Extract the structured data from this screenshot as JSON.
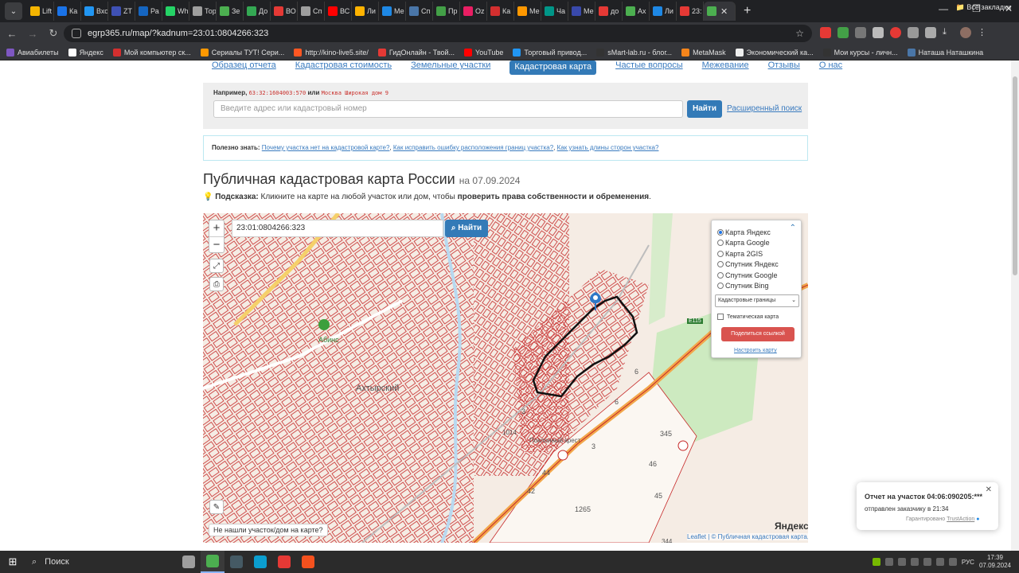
{
  "browser": {
    "tabs": [
      {
        "label": "Lift",
        "color": "#f4b400"
      },
      {
        "label": "Ка",
        "color": "#1a73e8"
      },
      {
        "label": "Вхо",
        "color": "#2196f3"
      },
      {
        "label": "ZT",
        "color": "#3f51b5"
      },
      {
        "label": "Ра",
        "color": "#1565c0"
      },
      {
        "label": "Wh",
        "color": "#25d366"
      },
      {
        "label": "Тор",
        "color": "#9e9e9e"
      },
      {
        "label": "Зе",
        "color": "#4caf50"
      },
      {
        "label": "До",
        "color": "#34a853"
      },
      {
        "label": "ВО",
        "color": "#e53935"
      },
      {
        "label": "Сп",
        "color": "#9e9e9e"
      },
      {
        "label": "ВС",
        "color": "#ff0000"
      },
      {
        "label": "Ли",
        "color": "#ffb300"
      },
      {
        "label": "Ме",
        "color": "#1e88e5"
      },
      {
        "label": "Сп",
        "color": "#4a76a8"
      },
      {
        "label": "Пр",
        "color": "#43a047"
      },
      {
        "label": "Oz",
        "color": "#e91e63"
      },
      {
        "label": "Ка",
        "color": "#d32f2f"
      },
      {
        "label": "Ме",
        "color": "#ff9800"
      },
      {
        "label": "Ча",
        "color": "#009688"
      },
      {
        "label": "Ме",
        "color": "#3949ab"
      },
      {
        "label": "до",
        "color": "#e53935"
      },
      {
        "label": "Ах",
        "color": "#4caf50"
      },
      {
        "label": "Ли",
        "color": "#1e88e5"
      },
      {
        "label": "23:",
        "color": "#e53935"
      }
    ],
    "active_tab_color": "#4caf50",
    "url": "egrp365.ru/map/?kadnum=23:01:0804266:323",
    "bookmarks": [
      {
        "label": "Авиабилеты",
        "color": "#7e57c2"
      },
      {
        "label": "Яндекс",
        "color": "#ffffff"
      },
      {
        "label": "Мой компьютер ск...",
        "color": "#d32f2f"
      },
      {
        "label": "Сериалы ТУТ! Сери...",
        "color": "#ff9800"
      },
      {
        "label": "http://kino-live5.site/",
        "color": "#ff5722"
      },
      {
        "label": "ГидОнлайн - Твой...",
        "color": "#e53935"
      },
      {
        "label": "YouTube",
        "color": "#ff0000"
      },
      {
        "label": "Торговый привод...",
        "color": "#2196f3"
      },
      {
        "label": "sMart-lab.ru - блог...",
        "color": "#333333"
      },
      {
        "label": "MetaMask",
        "color": "#f6851b"
      },
      {
        "label": "Экономический ка...",
        "color": "#eeeeee"
      },
      {
        "label": "Мои курсы - личн...",
        "color": "#333333"
      },
      {
        "label": "Наташа Наташкина",
        "color": "#4a76a8"
      }
    ],
    "all_bookmarks": "Все закладки"
  },
  "site": {
    "nav": [
      "Образец отчета",
      "Кадастровая стоимость",
      "Земельные участки",
      "Кадастровая карта",
      "Частые вопросы",
      "Межевание",
      "Отзывы",
      "О нас"
    ],
    "active_nav": "Кадастровая карта",
    "example_label": "Например,",
    "example_code": "63:32:1604003:570",
    "example_or": "или",
    "example_addr": "Москва Широкая дом 9",
    "search_placeholder": "Введите адрес или кадастровый номер",
    "find_button": "Найти",
    "advanced_search": "Расширенный поиск",
    "tip_label": "Полезно знать:",
    "tip_links": [
      "Почему участка нет на кадастровой карте?",
      "Как исправить ошибку расположения границ участка?",
      "Как узнать длины сторон участка?"
    ],
    "title": "Публичная кадастровая карта России",
    "title_date": "на 07.09.2024",
    "hint_label": "Подсказка:",
    "hint_text": "Кликните на карте на любой участок или дом, чтобы",
    "hint_bold": "проверить права собственности и обременения",
    "hint_end": "."
  },
  "map": {
    "search_value": "23:01:0804266:323",
    "find_button": "Найти",
    "layers": [
      "Карта Яндекс",
      "Карта Google",
      "Карта 2GIS",
      "Спутник Яндекс",
      "Спутник Google",
      "Спутник Bing"
    ],
    "selected_layer": "Карта Яндекс",
    "boundaries_select": "Кадастровые границы",
    "thematic_label": "Тематическая карта",
    "share_button": "Поделиться ссылкой",
    "config_link": "Настроить карту",
    "not_found": "Не нашли участок/дом на карте?",
    "attribution": "Leaflet | © Публичная кадастровая карта, ©",
    "yandex_logo": "Яндекс",
    "labels": {
      "town": "Ахтырский",
      "abinsk": "Абинс",
      "cross": "Поклонный крест",
      "road": "Е115",
      "lot_345": "345",
      "lot_46": "46",
      "lot_45": "45",
      "lot_44": "44",
      "lot_42": "42",
      "lot_1265": "1265",
      "lot_3a": "3",
      "lot_3b": "3",
      "lot_6a": "6",
      "lot_6b": "6",
      "lot_1014": "1014",
      "lot_344": "344"
    }
  },
  "notification": {
    "title": "Отчет на участок 04:06:090205:***",
    "subtitle": "отправлен заказчику в 21:34",
    "guarantee": "Гарантировано",
    "brand": "TrustAction"
  },
  "taskbar": {
    "search_label": "Поиск",
    "lang": "РУС",
    "time": "17:39",
    "date": "07.09.2024",
    "apps": [
      {
        "name": "task-view",
        "color": "#9e9e9e"
      },
      {
        "name": "chrome",
        "color": "#4caf50"
      },
      {
        "name": "calculator",
        "color": "#455a64"
      },
      {
        "name": "edge",
        "color": "#0b9ecf"
      },
      {
        "name": "opera",
        "color": "#e53935"
      },
      {
        "name": "telegram",
        "color": "#f4511e"
      }
    ]
  }
}
